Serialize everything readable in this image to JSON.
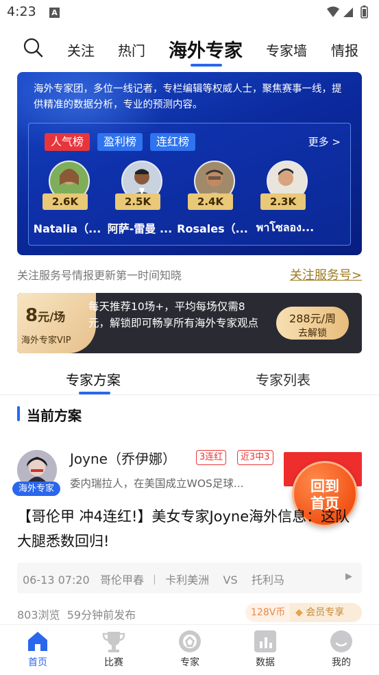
{
  "status_bar": {
    "time": "4:23",
    "notif_letter": "A"
  },
  "top_tabs": [
    {
      "label": "关注"
    },
    {
      "label": "热门"
    },
    {
      "label": "海外专家"
    },
    {
      "label": "专家墙"
    },
    {
      "label": "情报"
    }
  ],
  "banner": {
    "description": "海外专家团，多位一线记者，专栏编辑等权威人士，聚焦赛事一线，提供精准的数据分析，专业的预测内容。",
    "pills": [
      "人气榜",
      "盈利榜",
      "连红榜"
    ],
    "more_label": "更多 >",
    "experts": [
      {
        "count": "2.6K",
        "name": "Natalia（..."
      },
      {
        "count": "2.5K",
        "name": "阿萨-雷曼 ..."
      },
      {
        "count": "2.4K",
        "name": "Rosales（..."
      },
      {
        "count": "2.3K",
        "name": "พาโซลอง..."
      }
    ]
  },
  "follow": {
    "text": "关注服务号情报更新第一时间知晓",
    "link": "关注服务号>"
  },
  "vip": {
    "price": "8",
    "price_unit": "元/场",
    "label": "海外专家VIP",
    "text": "每天推荐10场+，平均每场仅需8元，解锁即可畅享所有海外专家观点",
    "btn_price": "288元/周",
    "btn_action": "去解锁"
  },
  "sub_tabs": [
    {
      "label": "专家方案"
    },
    {
      "label": "专家列表"
    }
  ],
  "section_title": "当前方案",
  "card": {
    "avatar_tag": "海外专家",
    "name": "Joyne（乔伊娜）",
    "tag1": "3连红",
    "tag2": "近3中3",
    "desc": "委内瑞拉人，在美国成立WOS足球...",
    "fab_line1": "回到",
    "fab_line2": "首页",
    "headline": "【哥伦甲 冲4连红!】美女专家Joyne海外信息：这队大腿悉数回归!",
    "match_time": "06-13 07:20",
    "match_league": "哥伦甲春",
    "home": "卡利美洲",
    "vs": "VS",
    "away": "托利马",
    "views": "803浏览",
    "published": "59分钟前发布",
    "coins": "128V币",
    "member": "会员专享"
  },
  "bottom_nav": [
    {
      "label": "首页"
    },
    {
      "label": "比赛"
    },
    {
      "label": "专家"
    },
    {
      "label": "数据"
    },
    {
      "label": "我的"
    }
  ],
  "colors": {
    "accent": "#2b67ec",
    "red": "#e8353c",
    "gold": "#e9c877"
  }
}
